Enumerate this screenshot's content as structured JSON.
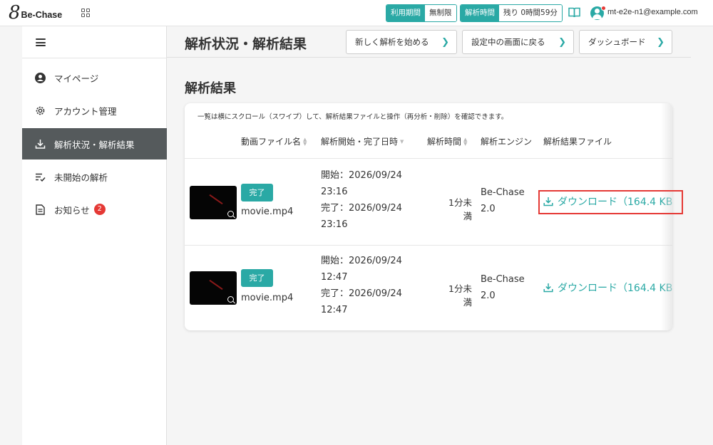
{
  "header": {
    "logo_mark": "8",
    "logo_text": "Be-Chase",
    "usage_period_label": "利用期間",
    "usage_period_value": "無制限",
    "analysis_time_label": "解析時間",
    "analysis_time_value": "残り 0時間59分",
    "user_email": "mt-e2e-n1@example.com"
  },
  "sidebar": {
    "items": [
      {
        "label": "マイページ",
        "icon": "user-circle-icon"
      },
      {
        "label": "アカウント管理",
        "icon": "gear-icon"
      },
      {
        "label": "解析状況・解析結果",
        "icon": "download-icon"
      },
      {
        "label": "未開始の解析",
        "icon": "list-check-icon"
      },
      {
        "label": "お知らせ",
        "icon": "document-icon",
        "badge": "2"
      }
    ]
  },
  "page": {
    "title": "解析状況・解析結果",
    "buttons": {
      "new_analysis": "新しく解析を始める",
      "back_to_settings": "設定中の画面に戻る",
      "dashboard": "ダッシュボード"
    },
    "section_title": "解析結果"
  },
  "table": {
    "note": "一覧は横にスクロール（スワイプ）して、解析結果ファイルと操作（再分析・削除）を確認できます。",
    "columns": [
      "動画ファイル名",
      "解析開始・完了日時",
      "解析時間",
      "解析エンジン",
      "解析結果ファイル"
    ],
    "rows": [
      {
        "status": "完了",
        "filename": "movie.mp4",
        "start": "開始：2026/09/24",
        "start_time": "23:16",
        "end": "完了：2026/09/24",
        "end_time": "23:16",
        "duration": "1分未満",
        "engine": "Be-Chase",
        "engine_version": "2.0",
        "download": "ダウンロード（164.4 KB"
      },
      {
        "status": "完了",
        "filename": "movie.mp4",
        "start": "開始：2026/09/24",
        "start_time": "12:47",
        "end": "完了：2026/09/24",
        "end_time": "12:47",
        "duration": "1分未満",
        "engine": "Be-Chase",
        "engine_version": "2.0",
        "download": "ダウンロード（164.4 KB"
      }
    ]
  },
  "colors": {
    "accent": "#2aa9a5",
    "sidebar_active": "#555a5c",
    "highlight": "#e53935"
  }
}
